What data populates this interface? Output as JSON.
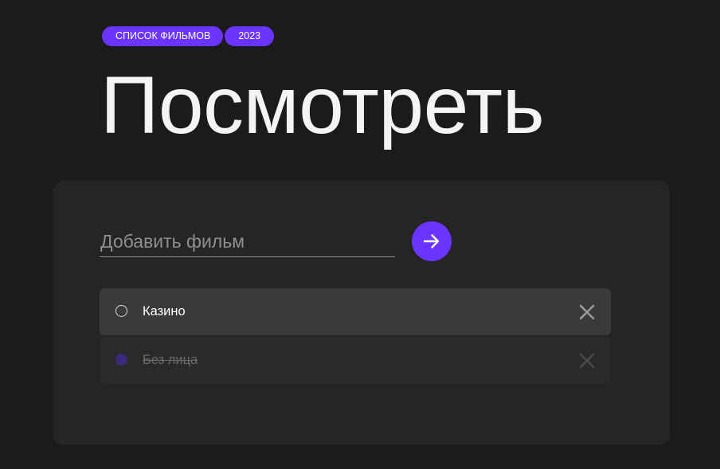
{
  "colors": {
    "accent": "#6a35ff",
    "background": "#1b1b1b",
    "card": "#252525",
    "item_active": "#3a3a3a",
    "item_done": "#2a2a2a",
    "remove_active": "#9a9a9a",
    "remove_done": "#4a4a4a"
  },
  "header": {
    "tags": [
      "СПИСОК ФИЛЬМОВ",
      "2023"
    ],
    "title": "Посмотреть"
  },
  "form": {
    "placeholder": "Добавить фильм",
    "value": "",
    "submit_icon": "arrow-right-icon"
  },
  "movies": [
    {
      "title": "Казино",
      "watched": false,
      "remove_icon": "close-icon"
    },
    {
      "title": "Без лица",
      "watched": true,
      "remove_icon": "close-icon"
    }
  ]
}
